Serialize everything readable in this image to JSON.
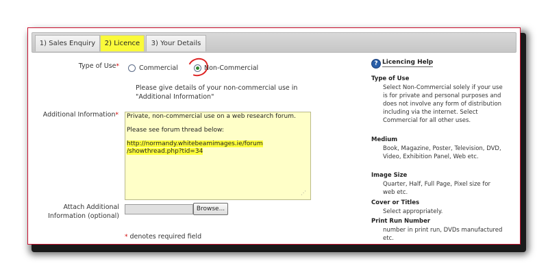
{
  "tabs": [
    {
      "label": "1) Sales Enquiry"
    },
    {
      "label": "2) Licence"
    },
    {
      "label": "3) Your Details"
    }
  ],
  "form": {
    "type_of_use_label": "Type of Use",
    "required_mark": "*",
    "options": {
      "commercial": "Commercial",
      "non_commercial": "Non-Commercial"
    },
    "selected_option": "Non-Commercial",
    "instruction": "Please give details of your non-commercial use in \"Additional Information\"",
    "additional_info_label": "Additional Information",
    "additional_info_value": {
      "line1": "Private, non-commercial use on a web research forum.",
      "line2": "Please see forum thread below:",
      "link1": "http://normandy.whitebeamimages.ie/forum",
      "link2": "/showthread.php?tid=34"
    },
    "attach_label_line1": "Attach Additional",
    "attach_label_line2": "Information (optional)",
    "browse_label": "Browse...",
    "required_note": "denotes required field"
  },
  "help": {
    "icon": "question-icon",
    "title": "Licencing Help",
    "sections": [
      {
        "heading": "Type of Use",
        "text": "Select Non-Commercial solely if your use is for private and personal purposes and does not involve any form of distribution including via the internet. Select Commercial for all other uses."
      },
      {
        "heading": "Medium",
        "text": "Book, Magazine, Poster, Television, DVD, Video, Exhibition Panel, Web etc."
      },
      {
        "heading": "Image Size",
        "text": "Quarter, Half, Full Page, Pixel size for web etc."
      },
      {
        "heading": "Cover or Titles",
        "text": "Select appropriately."
      },
      {
        "heading": "Print Run Number",
        "text": "number in print run, DVDs manufactured etc."
      }
    ]
  },
  "colors": {
    "active_tab": "#fafa3a",
    "textarea_bg": "#ffffc8",
    "frame_border": "#c8102e",
    "required": "#d00000"
  }
}
